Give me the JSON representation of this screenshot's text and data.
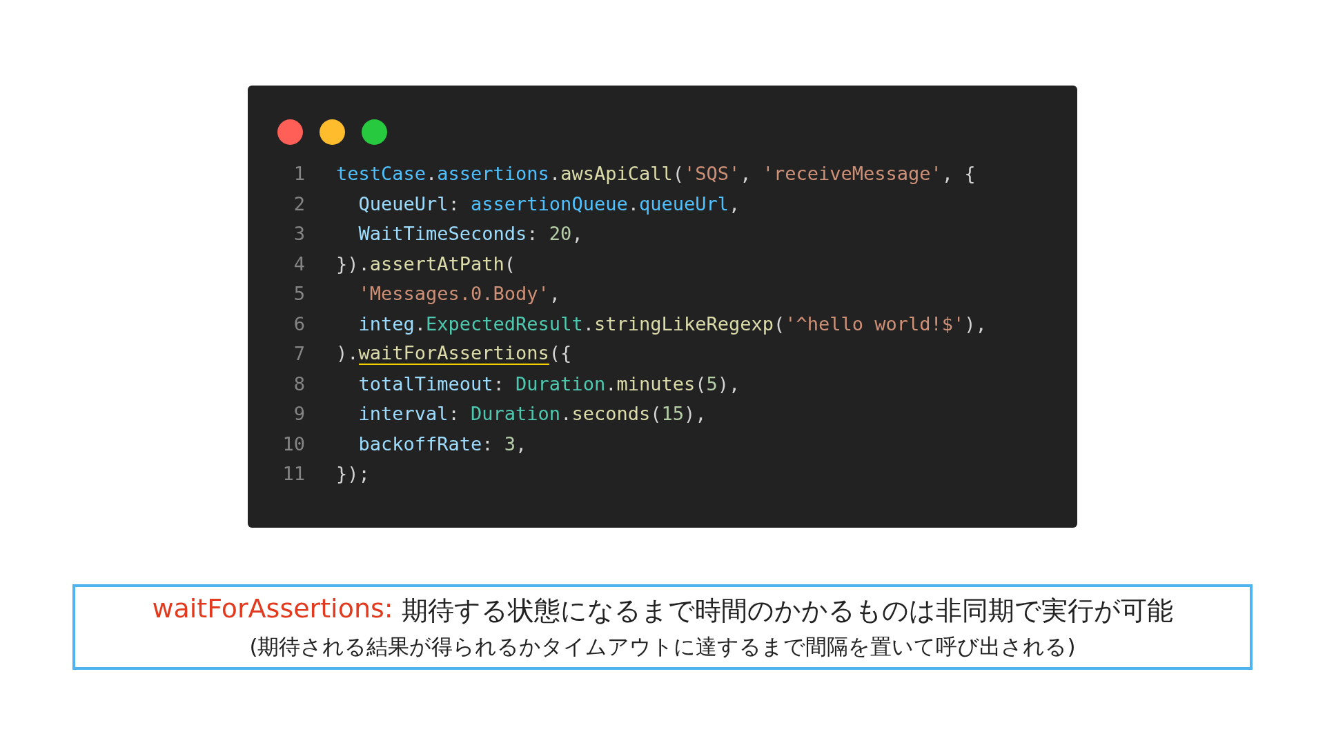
{
  "code_window": {
    "buttons": [
      {
        "color": "#ff5f56"
      },
      {
        "color": "#ffbd2e"
      },
      {
        "color": "#27c93f"
      }
    ],
    "lines": [
      {
        "number": "1",
        "tokens": [
          {
            "text": "testCase",
            "kind": "var"
          },
          {
            "text": ".",
            "kind": "punct"
          },
          {
            "text": "assertions",
            "kind": "var"
          },
          {
            "text": ".",
            "kind": "punct"
          },
          {
            "text": "awsApiCall",
            "kind": "func"
          },
          {
            "text": "(",
            "kind": "punct"
          },
          {
            "text": "'SQS'",
            "kind": "string"
          },
          {
            "text": ", ",
            "kind": "punct"
          },
          {
            "text": "'receiveMessage'",
            "kind": "string"
          },
          {
            "text": ", {",
            "kind": "punct"
          }
        ]
      },
      {
        "number": "2",
        "tokens": [
          {
            "text": "  QueueUrl",
            "kind": "prop"
          },
          {
            "text": ": ",
            "kind": "punct"
          },
          {
            "text": "assertionQueue",
            "kind": "var"
          },
          {
            "text": ".",
            "kind": "punct"
          },
          {
            "text": "queueUrl",
            "kind": "var"
          },
          {
            "text": ",",
            "kind": "punct"
          }
        ]
      },
      {
        "number": "3",
        "tokens": [
          {
            "text": "  WaitTimeSeconds",
            "kind": "prop"
          },
          {
            "text": ": ",
            "kind": "punct"
          },
          {
            "text": "20",
            "kind": "number"
          },
          {
            "text": ",",
            "kind": "punct"
          }
        ]
      },
      {
        "number": "4",
        "tokens": [
          {
            "text": "}).",
            "kind": "punct"
          },
          {
            "text": "assertAtPath",
            "kind": "func"
          },
          {
            "text": "(",
            "kind": "punct"
          }
        ]
      },
      {
        "number": "5",
        "tokens": [
          {
            "text": "  'Messages.0.Body'",
            "kind": "string"
          },
          {
            "text": ",",
            "kind": "punct"
          }
        ]
      },
      {
        "number": "6",
        "tokens": [
          {
            "text": "  integ",
            "kind": "prop"
          },
          {
            "text": ".",
            "kind": "punct"
          },
          {
            "text": "ExpectedResult",
            "kind": "class"
          },
          {
            "text": ".",
            "kind": "punct"
          },
          {
            "text": "stringLikeRegexp",
            "kind": "func"
          },
          {
            "text": "(",
            "kind": "punct"
          },
          {
            "text": "'^hello world!$'",
            "kind": "string"
          },
          {
            "text": "),",
            "kind": "punct"
          }
        ]
      },
      {
        "number": "7",
        "tokens": [
          {
            "text": ").",
            "kind": "punct"
          },
          {
            "text": "waitForAssertions",
            "kind": "func",
            "underlined": true
          },
          {
            "text": "({",
            "kind": "punct"
          }
        ]
      },
      {
        "number": "8",
        "tokens": [
          {
            "text": "  totalTimeout",
            "kind": "prop"
          },
          {
            "text": ": ",
            "kind": "punct"
          },
          {
            "text": "Duration",
            "kind": "class"
          },
          {
            "text": ".",
            "kind": "punct"
          },
          {
            "text": "minutes",
            "kind": "func"
          },
          {
            "text": "(",
            "kind": "punct"
          },
          {
            "text": "5",
            "kind": "number"
          },
          {
            "text": "),",
            "kind": "punct"
          }
        ]
      },
      {
        "number": "9",
        "tokens": [
          {
            "text": "  interval",
            "kind": "prop"
          },
          {
            "text": ": ",
            "kind": "punct"
          },
          {
            "text": "Duration",
            "kind": "class"
          },
          {
            "text": ".",
            "kind": "punct"
          },
          {
            "text": "seconds",
            "kind": "func"
          },
          {
            "text": "(",
            "kind": "punct"
          },
          {
            "text": "15",
            "kind": "number"
          },
          {
            "text": "),",
            "kind": "punct"
          }
        ]
      },
      {
        "number": "10",
        "tokens": [
          {
            "text": "  backoffRate",
            "kind": "prop"
          },
          {
            "text": ": ",
            "kind": "punct"
          },
          {
            "text": "3",
            "kind": "number"
          },
          {
            "text": ",",
            "kind": "punct"
          }
        ]
      },
      {
        "number": "11",
        "tokens": [
          {
            "text": "});",
            "kind": "punct"
          }
        ]
      }
    ]
  },
  "caption": {
    "lines": [
      [
        {
          "text": "waitForAssertions:",
          "kind": "keyword"
        },
        {
          "text": "期待する状態になるまで時間のかかるものは非同期で実行が可能",
          "kind": "plain"
        }
      ],
      [
        {
          "text": "(期待される結果が得られるかタイムアウトに達するまで間隔を置いて呼び出される)",
          "kind": "plain"
        }
      ]
    ]
  }
}
